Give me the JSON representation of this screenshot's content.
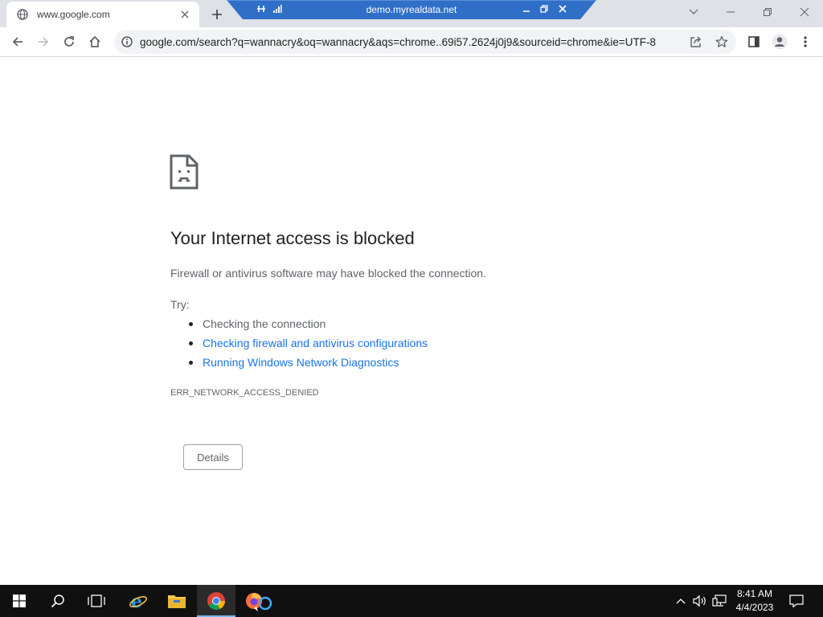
{
  "browser": {
    "tab": {
      "title": "www.google.com",
      "favicon": "globe-icon"
    },
    "new_tab_icon": "plus-icon",
    "window_controls": [
      "chevron-down-icon",
      "minimize-icon",
      "restore-icon",
      "close-icon"
    ]
  },
  "remote_session": {
    "title": "demo.myrealdata.net",
    "icons": [
      "pin-icon",
      "signal-icon",
      "minimize-icon",
      "restore-icon",
      "close-icon"
    ]
  },
  "toolbar": {
    "back_icon": "arrow-left-icon",
    "forward_icon": "arrow-right-icon",
    "reload_icon": "reload-icon",
    "home_icon": "home-icon",
    "url": "google.com/search?q=wannacry&oq=wannacry&aqs=chrome..69i57.2624j0j9&sourceid=chrome&ie=UTF-8",
    "share_icon": "share-icon",
    "bookmark_icon": "star-icon",
    "sidepanel_icon": "side-panel-icon",
    "profile_icon": "profile-icon",
    "menu_icon": "kebab-menu-icon"
  },
  "error_page": {
    "title": "Your Internet access is blocked",
    "description": "Firewall or antivirus software may have blocked the connection.",
    "try_label": "Try:",
    "suggestions": [
      {
        "text": "Checking the connection",
        "is_link": false
      },
      {
        "text": "Checking firewall and antivirus configurations",
        "is_link": true
      },
      {
        "text": "Running Windows Network Diagnostics",
        "is_link": true
      }
    ],
    "error_code": "ERR_NETWORK_ACCESS_DENIED",
    "details_button": "Details"
  },
  "taskbar": {
    "apps": [
      "windows-start-icon",
      "search-icon",
      "task-view-icon",
      "internet-explorer-icon",
      "file-explorer-icon",
      "chrome-icon",
      "firefox-icon"
    ],
    "tray": [
      "chevron-up-icon",
      "volume-icon",
      "network-icon"
    ],
    "time": "8:41 AM",
    "date": "4/4/2023",
    "notification_icon": "notification-icon"
  },
  "colors": {
    "link": "#1a73e8",
    "title_text": "#202124",
    "body_text": "#5f6368",
    "tabstrip_bg": "#dee1e6",
    "remote_bar": "#2f6fc7",
    "taskbar_bg": "#101010"
  }
}
